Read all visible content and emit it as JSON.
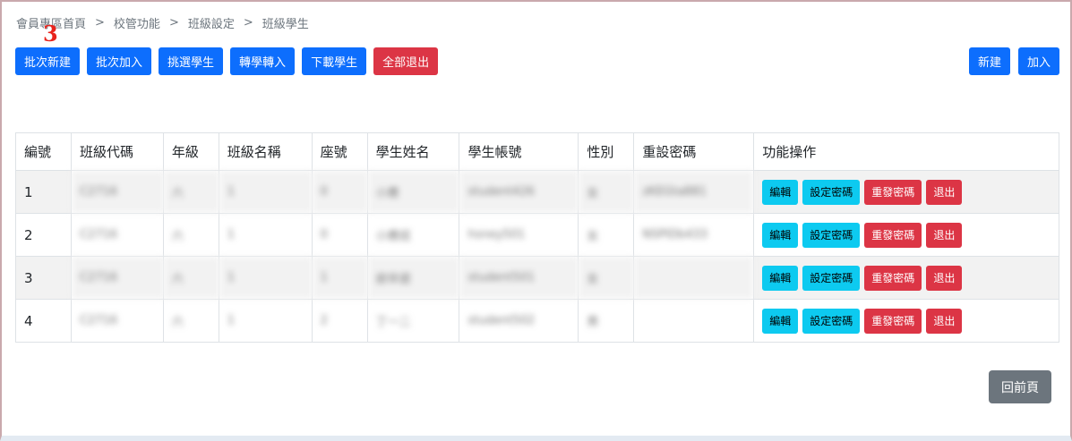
{
  "breadcrumb": {
    "items": [
      "會員專區首頁",
      "校管功能",
      "班級設定",
      "班級學生"
    ],
    "separator": ">"
  },
  "annotation_text": "3",
  "toolbar": {
    "batch_create": "批次新建",
    "batch_add": "批次加入",
    "select_students": "挑選學生",
    "transfer_in": "轉學轉入",
    "download_students": "下載學生",
    "exit_all": "全部退出",
    "create": "新建",
    "add": "加入"
  },
  "table": {
    "headers": [
      "編號",
      "班級代碼",
      "年級",
      "班級名稱",
      "座號",
      "學生姓名",
      "學生帳號",
      "性別",
      "重設密碼",
      "功能操作"
    ],
    "rows": [
      {
        "no": "1",
        "class_code": "C2716",
        "grade": "六",
        "class_name": "1",
        "seat": "0",
        "name": "小應",
        "account": "student426",
        "gender": "女",
        "reset_pw": "zKEGta881"
      },
      {
        "no": "2",
        "class_code": "C2716",
        "grade": "六",
        "class_name": "1",
        "seat": "0",
        "name": "小應班",
        "account": "hsney501",
        "gender": "女",
        "reset_pw": "NSPIDb433"
      },
      {
        "no": "3",
        "class_code": "C2716",
        "grade": "六",
        "class_name": "1",
        "seat": "1",
        "name": "欲卒遊",
        "account": "student501",
        "gender": "女",
        "reset_pw": ""
      },
      {
        "no": "4",
        "class_code": "C2716",
        "grade": "六",
        "class_name": "1",
        "seat": "2",
        "name": "丁一二",
        "account": "student502",
        "gender": "男",
        "reset_pw": ""
      }
    ],
    "actions": {
      "edit": "編輯",
      "set_password": "設定密碼",
      "resend_password": "重發密碼",
      "exit": "退出"
    }
  },
  "back_button": "回前頁",
  "colors": {
    "primary": "#0d6efd",
    "danger": "#dc3545",
    "info": "#0dcaf0",
    "secondary": "#6c757d",
    "annotation": "#e8231c"
  }
}
